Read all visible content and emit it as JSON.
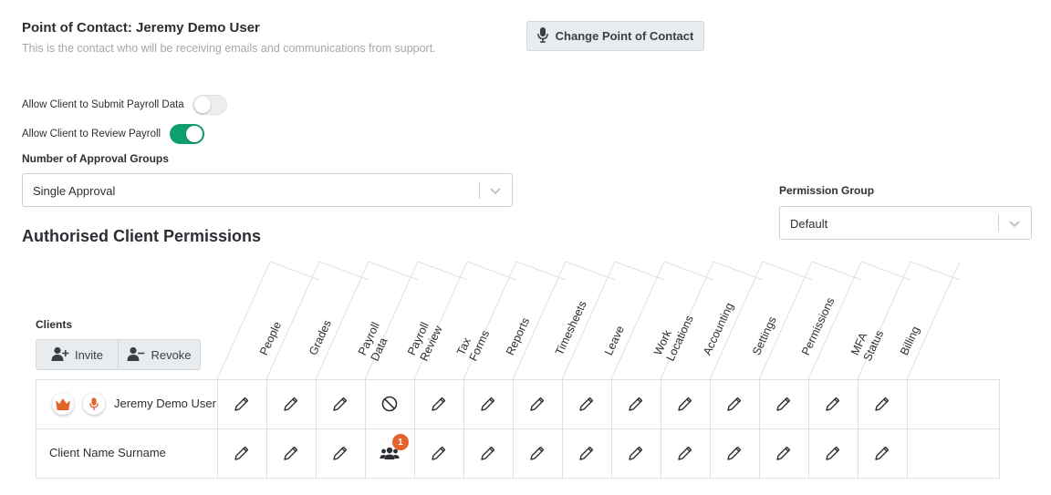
{
  "point_of_contact": {
    "title": "Point of Contact: Jeremy Demo User",
    "description": "This is the contact who will be receiving emails and communications from support.",
    "change_button": "Change Point of Contact"
  },
  "toggles": [
    {
      "label": "Allow Client to Submit Payroll Data",
      "state": "off"
    },
    {
      "label": "Allow Client to Review Payroll",
      "state": "on"
    }
  ],
  "approval_groups": {
    "label": "Number of Approval Groups",
    "value": "Single Approval"
  },
  "permission_group": {
    "label": "Permission Group",
    "value": "Default"
  },
  "section_title": "Authorised Client Permissions",
  "clients": {
    "label": "Clients",
    "invite": "Invite",
    "revoke": "Revoke"
  },
  "columns": [
    [
      "People"
    ],
    [
      "Grades"
    ],
    [
      "Payroll",
      "Data"
    ],
    [
      "Payroll",
      "Review"
    ],
    [
      "Tax",
      "Forms"
    ],
    [
      "Reports"
    ],
    [
      "Timesheets"
    ],
    [
      "Leave"
    ],
    [
      "Work",
      "Locations"
    ],
    [
      "Accounting"
    ],
    [
      "Settings"
    ],
    [
      "Permissions"
    ],
    [
      "MFA",
      "Status"
    ],
    [
      "Billing"
    ]
  ],
  "rows": [
    {
      "name": "Jeremy Demo User",
      "badges": [
        "crown-icon",
        "microphone-icon"
      ],
      "cells": [
        "edit",
        "edit",
        "edit",
        "blocked",
        "edit",
        "edit",
        "edit",
        "edit",
        "edit",
        "edit",
        "edit",
        "edit",
        "edit",
        "edit"
      ]
    },
    {
      "name": "Client Name Surname",
      "badges": [],
      "cells": [
        "edit",
        "edit",
        "edit",
        "group",
        "edit",
        "edit",
        "edit",
        "edit",
        "edit",
        "edit",
        "edit",
        "edit",
        "edit",
        "edit"
      ],
      "group_count": "1"
    }
  ],
  "colors": {
    "accent_green": "#0f9f6e",
    "accent_orange": "#e4632b"
  }
}
